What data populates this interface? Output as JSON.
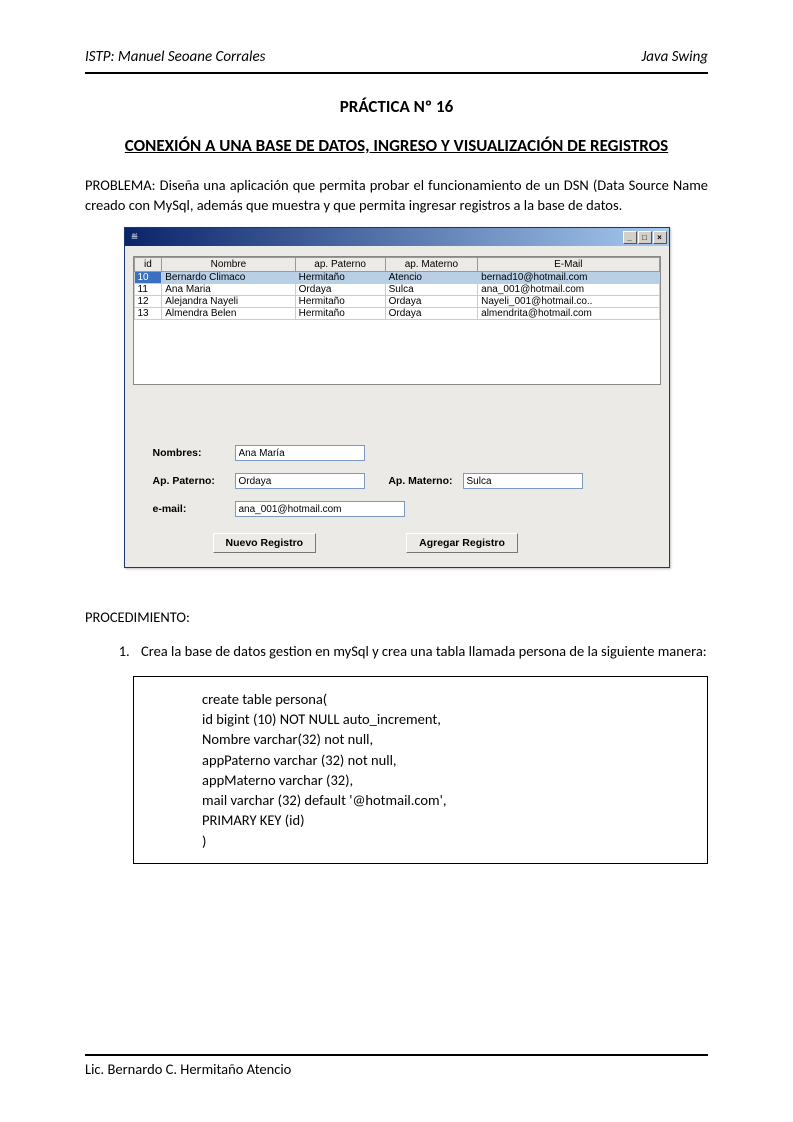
{
  "header": {
    "left": "ISTP: Manuel Seoane Corrales",
    "right": "Java Swing"
  },
  "title1": "PRÁCTICA Nº 16",
  "title2": "CONEXIÓN A UNA BASE DE DATOS, INGRESO Y VISUALIZACIÓN DE REGISTROS",
  "problem": "PROBLEMA: Diseña una aplicación que permita probar el funcionamiento de un DSN (Data Source Name creado con MySql, además que muestra y que permita ingresar registros a la base de datos.",
  "swing": {
    "java_icon": "≝",
    "ctrl_min": "_",
    "ctrl_max": "□",
    "ctrl_close": "×",
    "columns": [
      "id",
      "Nombre",
      "ap. Paterno",
      "ap. Materno",
      "E-Mail"
    ],
    "rows": [
      {
        "id": "10",
        "nombre": "Bernardo Climaco",
        "paterno": "Hermitaño",
        "materno": "Atencio",
        "email": "bernad10@hotmail.com",
        "selected": true
      },
      {
        "id": "11",
        "nombre": "Ana Maria",
        "paterno": "Ordaya",
        "materno": "Sulca",
        "email": "ana_001@hotmail.com",
        "selected": false
      },
      {
        "id": "12",
        "nombre": "Alejandra Nayeli",
        "paterno": "Hermitaño",
        "materno": "Ordaya",
        "email": "Nayeli_001@hotmail.co..",
        "selected": false
      },
      {
        "id": "13",
        "nombre": "Almendra Belen",
        "paterno": "Hermitaño",
        "materno": "Ordaya",
        "email": "almendrita@hotmail.com",
        "selected": false
      }
    ],
    "labels": {
      "nombres": "Nombres:",
      "paterno": "Ap. Paterno:",
      "materno": "Ap. Materno:",
      "email": "e-mail:"
    },
    "fields": {
      "nombres": "Ana María",
      "paterno": "Ordaya",
      "materno": "Sulca",
      "email": "ana_001@hotmail.com"
    },
    "buttons": {
      "nuevo": "Nuevo Registro",
      "agregar": "Agregar Registro"
    }
  },
  "procHeading": "PROCEDIMIENTO:",
  "procItem1": "Crea la base de datos gestion en mySql y crea una tabla llamada persona de la siguiente manera:",
  "code": [
    "create table persona(",
    "id bigint (10) NOT NULL auto_increment,",
    "Nombre varchar(32) not null,",
    "appPaterno varchar (32) not null,",
    "appMaterno varchar (32),",
    "mail varchar (32) default '@hotmail.com',",
    "PRIMARY KEY (id)",
    ")"
  ],
  "footer": "Lic. Bernardo C. Hermitaño Atencio"
}
